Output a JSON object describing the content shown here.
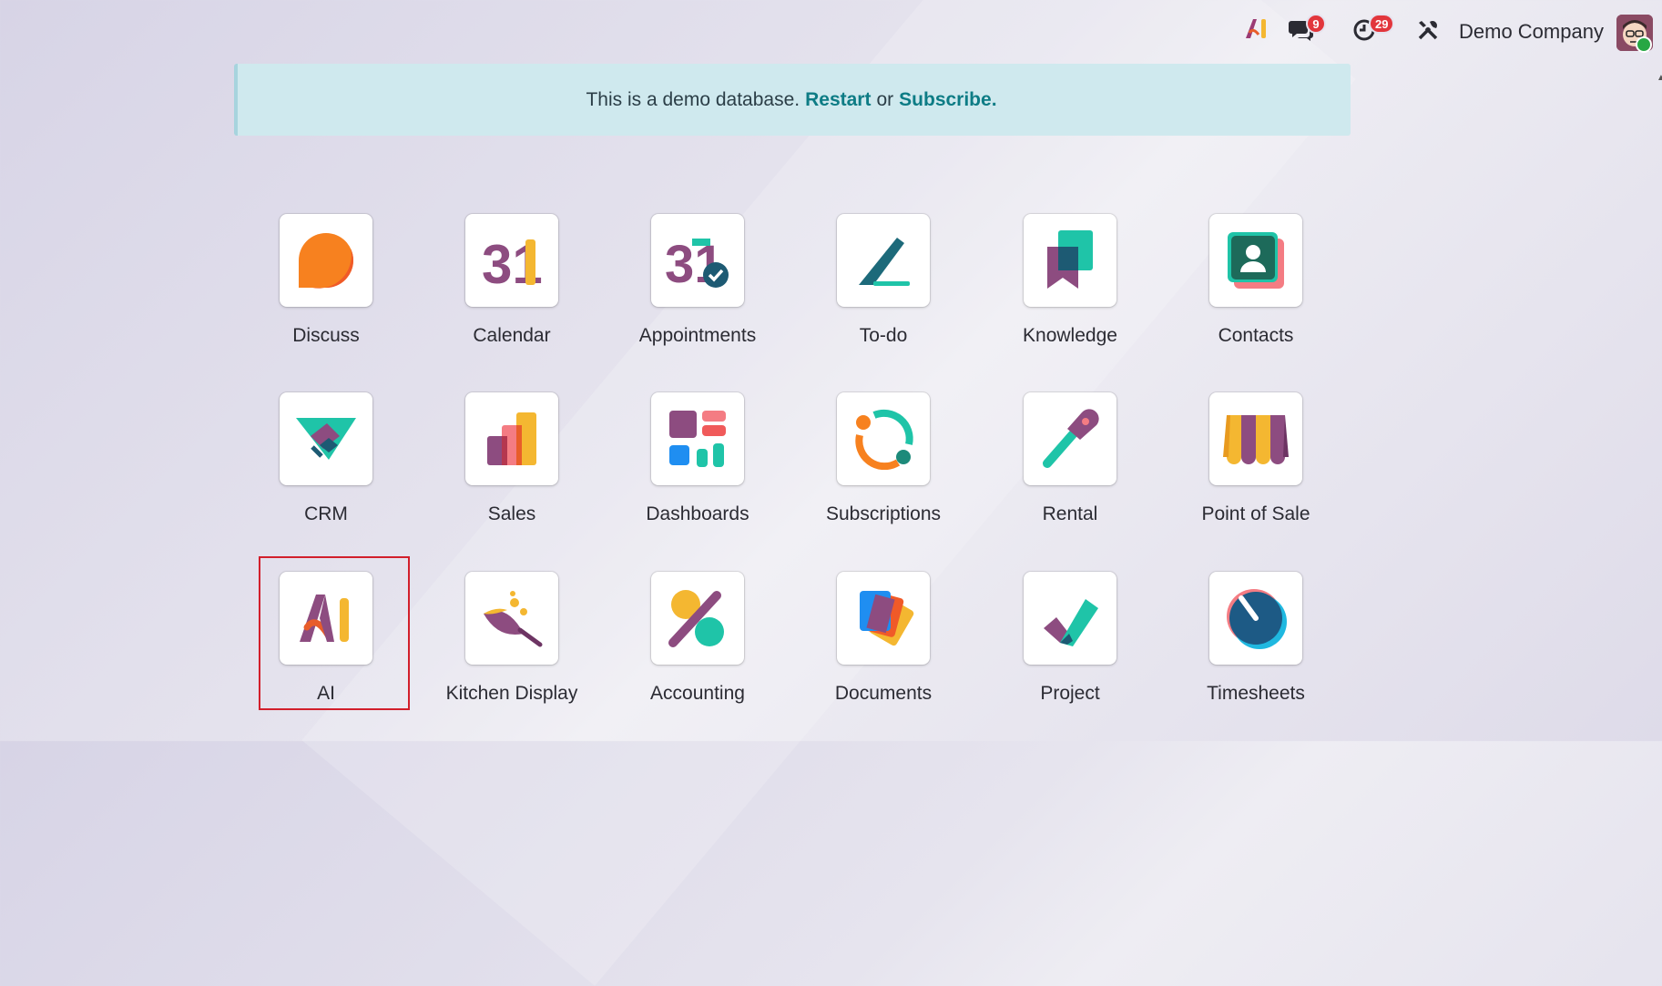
{
  "topbar": {
    "ai_icon": "ai-logo-icon",
    "messages_badge": "9",
    "activities_badge": "29",
    "company_name": "Demo Company"
  },
  "banner": {
    "text": "This is a demo database.",
    "restart_label": "Restart",
    "or_text": "or",
    "subscribe_label": "Subscribe."
  },
  "apps": [
    {
      "label": "Discuss",
      "icon": "discuss-icon"
    },
    {
      "label": "Calendar",
      "icon": "calendar-icon"
    },
    {
      "label": "Appointments",
      "icon": "appointments-icon"
    },
    {
      "label": "To-do",
      "icon": "todo-icon"
    },
    {
      "label": "Knowledge",
      "icon": "knowledge-icon"
    },
    {
      "label": "Contacts",
      "icon": "contacts-icon"
    },
    {
      "label": "CRM",
      "icon": "crm-icon"
    },
    {
      "label": "Sales",
      "icon": "sales-icon"
    },
    {
      "label": "Dashboards",
      "icon": "dashboards-icon"
    },
    {
      "label": "Subscriptions",
      "icon": "subscriptions-icon"
    },
    {
      "label": "Rental",
      "icon": "rental-icon"
    },
    {
      "label": "Point of Sale",
      "icon": "point-of-sale-icon"
    },
    {
      "label": "AI",
      "icon": "ai-icon"
    },
    {
      "label": "Kitchen Display",
      "icon": "kitchen-display-icon"
    },
    {
      "label": "Accounting",
      "icon": "accounting-icon"
    },
    {
      "label": "Documents",
      "icon": "documents-icon"
    },
    {
      "label": "Project",
      "icon": "project-icon"
    },
    {
      "label": "Timesheets",
      "icon": "timesheets-icon"
    }
  ],
  "calendar_icon_text": "31",
  "appointments_icon_text": "31",
  "colors": {
    "banner_bg": "#cfe9ee",
    "banner_link": "#0d7c85",
    "badge": "#e2363c",
    "selection_frame": "#d21f2b"
  }
}
